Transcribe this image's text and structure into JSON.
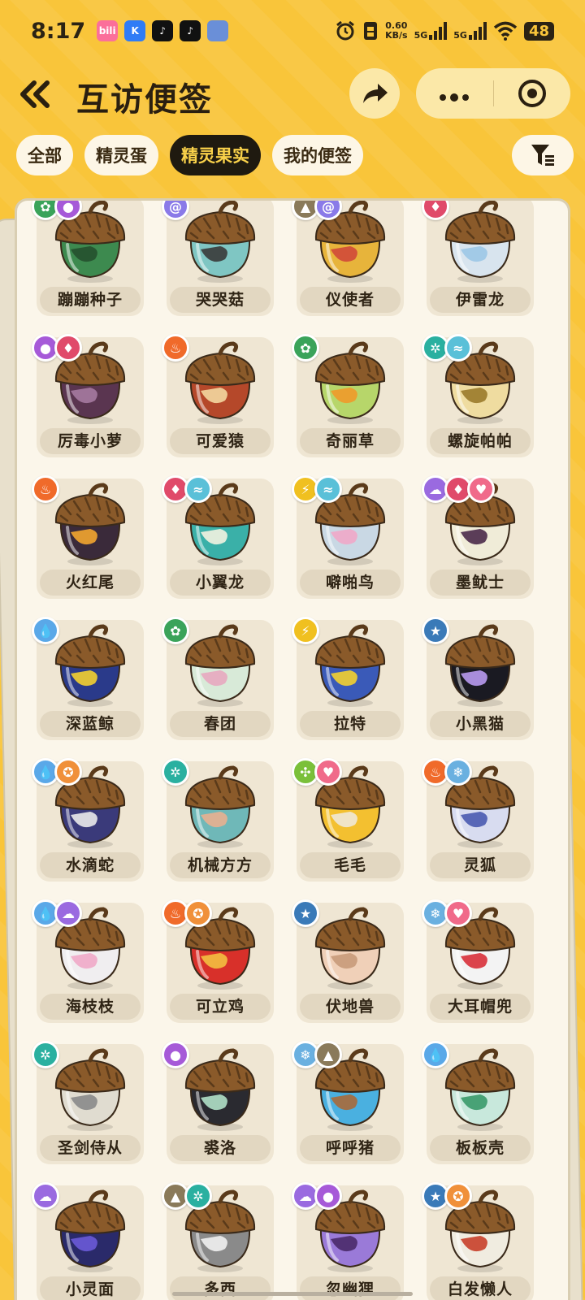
{
  "status_bar": {
    "time": "8:17",
    "app_icons": [
      {
        "name": "bilibili-icon",
        "label": "bili",
        "color": "#fb6f9a"
      },
      {
        "name": "k-app-icon",
        "label": "K",
        "color": "#2f7cf6"
      },
      {
        "name": "douyin-icon",
        "label": "♪",
        "color": "#111111"
      },
      {
        "name": "douyin-icon",
        "label": "♪",
        "color": "#111111"
      },
      {
        "name": "game-app-icon",
        "label": "",
        "color": "#6a8fd8"
      }
    ],
    "net_speed_value": "0.60",
    "net_speed_unit": "KB/s",
    "signal_1": "5G",
    "signal_2": "5G",
    "battery": "48"
  },
  "header": {
    "title": "互访便签"
  },
  "tabs": [
    {
      "label": "全部",
      "active": false
    },
    {
      "label": "精灵蛋",
      "active": false
    },
    {
      "label": "精灵果实",
      "active": true
    },
    {
      "label": "我的便签",
      "active": false
    }
  ],
  "colors": {
    "background": "#f9c53a",
    "tab_active_bg": "#1f1a10",
    "tab_active_text": "#f9d14a"
  },
  "items": [
    {
      "name": "蹦蹦种子",
      "badges": [
        "grass",
        "poison"
      ],
      "body": "#3d8a4f",
      "accent": "#25502d"
    },
    {
      "name": "哭哭菇",
      "badges": [
        "spiral"
      ],
      "body": "#7fc6c3",
      "accent": "#3a3a3a"
    },
    {
      "name": "仪使者",
      "badges": [
        "ground",
        "spiral"
      ],
      "body": "#e7b43b",
      "accent": "#d0493a"
    },
    {
      "name": "伊雷龙",
      "badges": [
        "demon"
      ],
      "body": "#d8e4ee",
      "accent": "#9cc6e6"
    },
    {
      "name": "厉毒小萝",
      "badges": [
        "poison",
        "demon"
      ],
      "body": "#5a3550",
      "accent": "#a57aa0"
    },
    {
      "name": "可爱猿",
      "badges": [
        "fire"
      ],
      "body": "#b5482a",
      "accent": "#f3d7a0"
    },
    {
      "name": "奇丽草",
      "badges": [
        "grass"
      ],
      "body": "#b7d66a",
      "accent": "#f09a2a"
    },
    {
      "name": "螺旋帕帕",
      "badges": [
        "mech",
        "wing"
      ],
      "body": "#efdca0",
      "accent": "#9a7a2a"
    },
    {
      "name": "火红尾",
      "badges": [
        "fire"
      ],
      "body": "#3a2a3a",
      "accent": "#f3a530"
    },
    {
      "name": "小翼龙",
      "badges": [
        "demon",
        "wing"
      ],
      "body": "#3ab0a8",
      "accent": "#f3f3e0"
    },
    {
      "name": "噼啪鸟",
      "badges": [
        "electric",
        "wing"
      ],
      "body": "#c9d8e4",
      "accent": "#f0a8c8"
    },
    {
      "name": "墨鱿士",
      "badges": [
        "ghost",
        "demon",
        "cute"
      ],
      "body": "#f0ecd8",
      "accent": "#4a2a4a"
    },
    {
      "name": "深蓝鲸",
      "badges": [
        "water"
      ],
      "body": "#2a3a8a",
      "accent": "#f3d030"
    },
    {
      "name": "春团",
      "badges": [
        "grass"
      ],
      "body": "#d8ead8",
      "accent": "#e8a8c0"
    },
    {
      "name": "拉特",
      "badges": [
        "electric"
      ],
      "body": "#3a5ab8",
      "accent": "#f3d030"
    },
    {
      "name": "小黑猫",
      "badges": [
        "normal"
      ],
      "body": "#1a1a22",
      "accent": "#b89af0"
    },
    {
      "name": "水滴蛇",
      "badges": [
        "water",
        "light"
      ],
      "body": "#3a3a7a",
      "accent": "#eaeaea"
    },
    {
      "name": "机械方方",
      "badges": [
        "mech"
      ],
      "body": "#6fb8b8",
      "accent": "#e8b090"
    },
    {
      "name": "毛毛",
      "badges": [
        "bug",
        "cute"
      ],
      "body": "#f3c030",
      "accent": "#f0e8d8"
    },
    {
      "name": "灵狐",
      "badges": [
        "fire",
        "ice"
      ],
      "body": "#d8dcf0",
      "accent": "#4a5ab0"
    },
    {
      "name": "海枝枝",
      "badges": [
        "water",
        "ghost"
      ],
      "body": "#f0eef0",
      "accent": "#f0a8c8"
    },
    {
      "name": "可立鸡",
      "badges": [
        "fire",
        "light"
      ],
      "body": "#d8302a",
      "accent": "#f3c040"
    },
    {
      "name": "伏地兽",
      "badges": [
        "normal"
      ],
      "body": "#f0d0b8",
      "accent": "#c89a7a"
    },
    {
      "name": "大耳帽兜",
      "badges": [
        "ice",
        "cute"
      ],
      "body": "#f3f3f3",
      "accent": "#d8303a"
    },
    {
      "name": "圣剑侍从",
      "badges": [
        "mech"
      ],
      "body": "#e0dcd0",
      "accent": "#8a8a8a"
    },
    {
      "name": "裘洛",
      "badges": [
        "poison"
      ],
      "body": "#2a2a30",
      "accent": "#b0e0c8"
    },
    {
      "name": "呼呼猪",
      "badges": [
        "ice",
        "ground"
      ],
      "body": "#4ab0e0",
      "accent": "#a86a3a"
    },
    {
      "name": "板板壳",
      "badges": [
        "water"
      ],
      "body": "#c8e8dc",
      "accent": "#3a9a6a"
    },
    {
      "name": "小灵面",
      "badges": [
        "ghost"
      ],
      "body": "#2a2a6a",
      "accent": "#6a5ad8"
    },
    {
      "name": "多西",
      "badges": [
        "ground",
        "mech"
      ],
      "body": "#8a8a8a",
      "accent": "#f0f0f0"
    },
    {
      "name": "忽幽狸",
      "badges": [
        "ghost",
        "poison"
      ],
      "body": "#9a7ad8",
      "accent": "#4a2a6a"
    },
    {
      "name": "白发懒人",
      "badges": [
        "normal",
        "light"
      ],
      "body": "#f0ece0",
      "accent": "#c8402a"
    }
  ],
  "badge_types": {
    "grass": {
      "color": "#3aa35a",
      "glyph": "✿"
    },
    "poison": {
      "color": "#a65ad8",
      "glyph": "●"
    },
    "spiral": {
      "color": "#8a7ae8",
      "glyph": "@"
    },
    "ground": {
      "color": "#8a7a5a",
      "glyph": "▲"
    },
    "demon": {
      "color": "#e04a6a",
      "glyph": "♦"
    },
    "fire": {
      "color": "#f06a2a",
      "glyph": "♨"
    },
    "mech": {
      "color": "#2ab0a0",
      "glyph": "✲"
    },
    "wing": {
      "color": "#5ac0d8",
      "glyph": "≈"
    },
    "electric": {
      "color": "#f0c020",
      "glyph": "⚡"
    },
    "ghost": {
      "color": "#9a6ae0",
      "glyph": "☁"
    },
    "cute": {
      "color": "#f06a8a",
      "glyph": "♥"
    },
    "water": {
      "color": "#5aa8e8",
      "glyph": "💧"
    },
    "normal": {
      "color": "#3a7ab8",
      "glyph": "★"
    },
    "light": {
      "color": "#f0903a",
      "glyph": "✪"
    },
    "bug": {
      "color": "#7ac03a",
      "glyph": "✣"
    },
    "ice": {
      "color": "#6ab0e0",
      "glyph": "❄"
    }
  }
}
